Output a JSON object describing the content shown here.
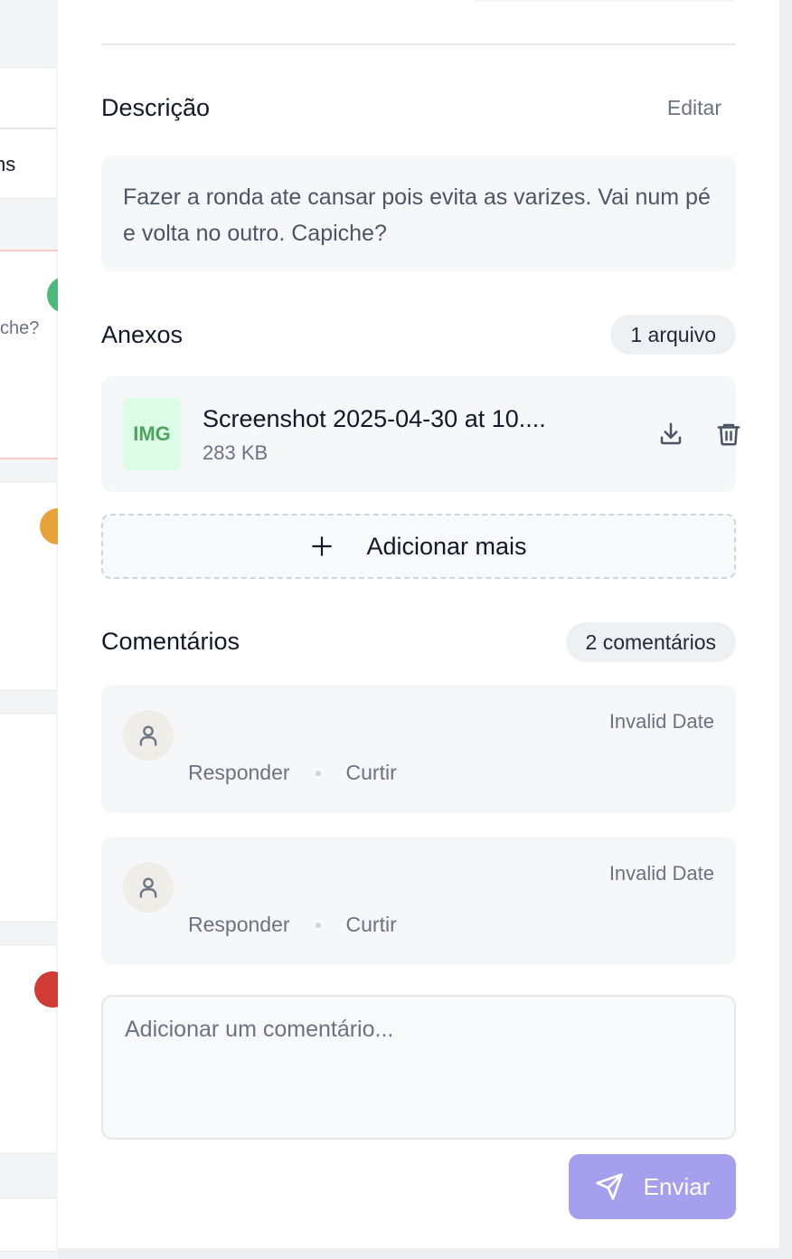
{
  "background_board": {
    "partial_texts": [
      "ns",
      "che?"
    ]
  },
  "description": {
    "title": "Descrição",
    "edit_label": "Editar",
    "text": "Fazer a ronda ate cansar pois evita as varizes. Vai num pé e volta no outro. Capiche?"
  },
  "attachments": {
    "title": "Anexos",
    "count_label": "1 arquivo",
    "files": [
      {
        "thumb_label": "IMG",
        "name": "Screenshot 2025-04-30 at 10....",
        "size": "283 KB"
      }
    ],
    "add_more_label": "Adicionar mais"
  },
  "comments": {
    "title": "Comentários",
    "count_label": "2 comentários",
    "items": [
      {
        "date": "Invalid Date",
        "reply_label": "Responder",
        "like_label": "Curtir"
      },
      {
        "date": "Invalid Date",
        "reply_label": "Responder",
        "like_label": "Curtir"
      }
    ],
    "input_placeholder": "Adicionar um comentário...",
    "send_label": "Enviar"
  },
  "colors": {
    "accent_button": "#a5a0ee",
    "file_thumb_bg": "#dcfce7",
    "file_thumb_text": "#4ea45e",
    "board_dots": [
      "#4cb87a",
      "#e8a23a",
      "#d13b35"
    ]
  },
  "icons": {
    "download": "download-icon",
    "delete": "trash-icon",
    "add": "plus-icon",
    "avatar": "user-icon",
    "send": "send-icon"
  }
}
